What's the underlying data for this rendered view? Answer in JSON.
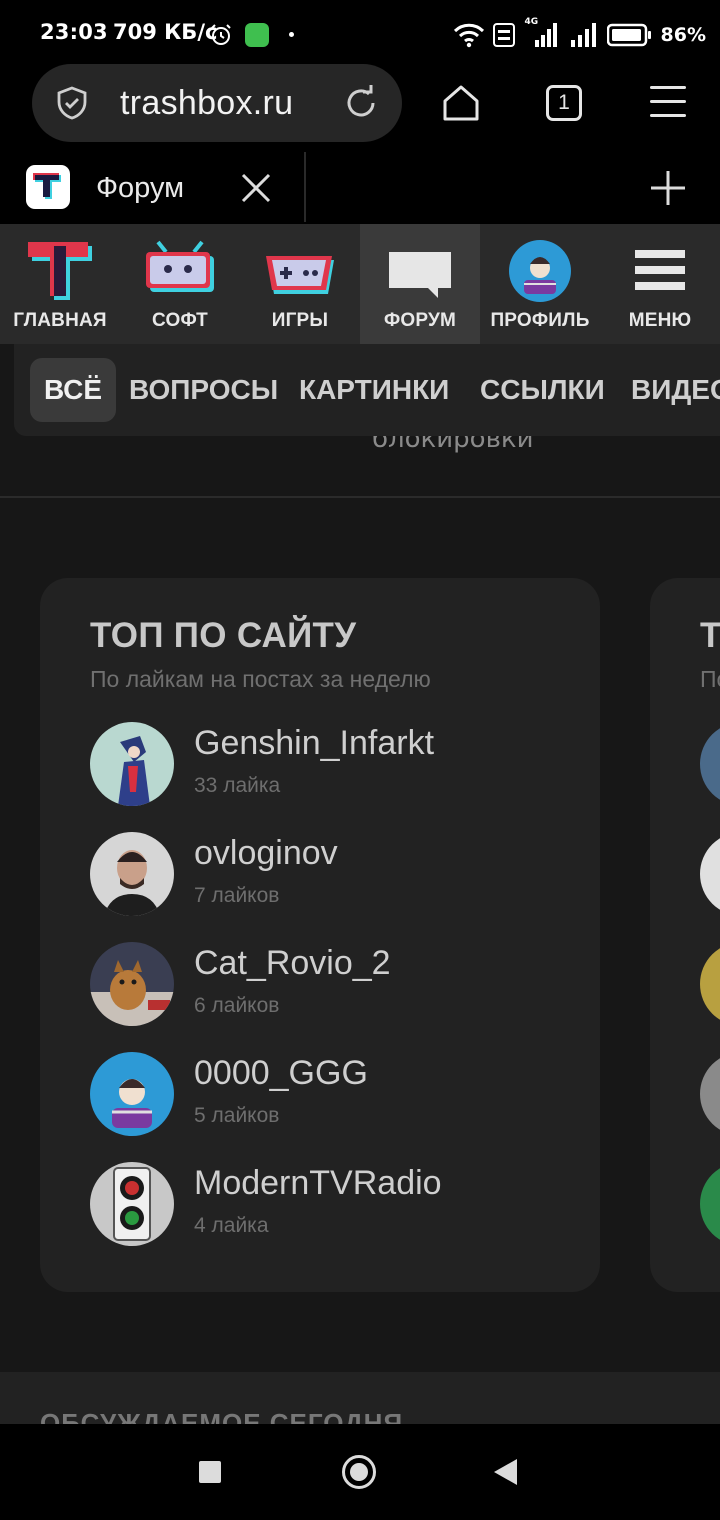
{
  "status_bar": {
    "time": "23:03",
    "speed": "709 КБ/с",
    "network": "4G",
    "battery": "86%"
  },
  "browser": {
    "url": "trashbox.ru",
    "tab_count": "1",
    "tab_title": "Форум"
  },
  "site_nav": {
    "items": [
      {
        "label": "ГЛАВНАЯ"
      },
      {
        "label": "СОФТ"
      },
      {
        "label": "ИГРЫ"
      },
      {
        "label": "ФОРУМ",
        "active": true
      },
      {
        "label": "ПРОФИЛЬ"
      },
      {
        "label": "МЕНЮ"
      }
    ]
  },
  "filters": {
    "items": [
      "ВСЁ",
      "ВОПРОСЫ",
      "КАРТИНКИ",
      "ССЫЛКИ",
      "ВИДЕО"
    ],
    "active": "ВСЁ"
  },
  "partial_text_above": "блокировки",
  "top_card": {
    "title": "ТОП ПО САЙТУ",
    "subtitle": "По лайкам на постах за неделю",
    "users": [
      {
        "name": "Genshin_Infarkt",
        "likes": "33 лайка"
      },
      {
        "name": "ovloginov",
        "likes": "7 лайков"
      },
      {
        "name": "Cat_Rovio_2",
        "likes": "6 лайков"
      },
      {
        "name": "0000_GGG",
        "likes": "5 лайков"
      },
      {
        "name": "ModernTVRadio",
        "likes": "4 лайка"
      }
    ]
  },
  "second_card": {
    "title_partial": "Т",
    "subtitle_partial": "По"
  },
  "next_section": {
    "title": "ОБСУЖДАЕМОЕ СЕГОДНЯ"
  },
  "colors": {
    "brand_red": "#e0364b",
    "brand_cyan": "#3fd0e0",
    "background": "#171717",
    "card": "#222222"
  }
}
